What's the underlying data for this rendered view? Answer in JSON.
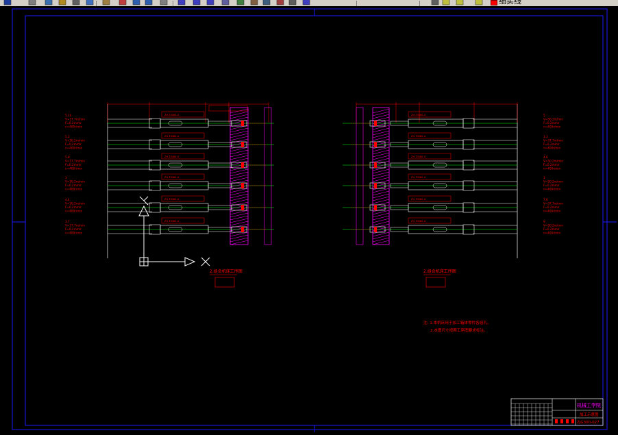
{
  "toolbar": {
    "buttons": [
      {
        "name": "save-icon"
      },
      {
        "name": "print-icon"
      },
      {
        "name": "preview-icon"
      },
      {
        "name": "publish-icon"
      },
      {
        "name": "cut-icon"
      },
      {
        "name": "copy-icon"
      },
      {
        "name": "paste-icon"
      },
      {
        "name": "match-properties-icon"
      },
      {
        "name": "undo-icon"
      },
      {
        "name": "redo-icon"
      },
      {
        "name": "pan-icon"
      },
      {
        "name": "zoom-realtime-icon"
      },
      {
        "name": "zoom-window-icon"
      },
      {
        "name": "zoom-previous-icon"
      },
      {
        "name": "properties-icon"
      },
      {
        "name": "design-center-icon"
      },
      {
        "name": "tool-palettes-icon"
      },
      {
        "name": "sheet-set-icon"
      },
      {
        "name": "markup-icon"
      },
      {
        "name": "calculator-icon"
      },
      {
        "name": "help-icon"
      },
      {
        "name": "layer-manager-icon"
      },
      {
        "name": "layer-visibility-icon"
      },
      {
        "name": "layer-freeze-icon"
      },
      {
        "name": "layer-lock-icon"
      }
    ],
    "current_layer": "细实线",
    "layer_color": "#ff0000"
  },
  "drawing": {
    "colors": {
      "frame": "#1a1aff",
      "annotation": "#ff0000",
      "geometry": "#ffffff",
      "centerline": "#00ff00",
      "hatch": "#ff00ff",
      "ucs": "#ffffff"
    },
    "left_view": {
      "labels": [
        [
          "5.10",
          "V=37.7m/min",
          "F=0.2mm/r",
          "n=400r/min"
        ],
        [
          "5.2",
          "V=50.2m/min",
          "F=0.2mm/r",
          "n=400r/min"
        ],
        [
          "5.8",
          "V=37.7m/min",
          "F=0.2mm/r",
          "n=400r/min"
        ],
        [
          "3",
          "V=50.2m/min",
          "F=0.2mm/r",
          "n=400r/min"
        ],
        [
          "4.4",
          "V=50.2m/min",
          "F=0.2mm/r",
          "n=400r/min"
        ],
        [
          "3.7",
          "V=37.7m/min",
          "F=0.2mm/r",
          "n=400r/min"
        ]
      ],
      "title": "2.组合机床工序图"
    },
    "right_view": {
      "labels": [
        [
          "5",
          "V=50.2m/min",
          "F=0.2mm/r",
          "n=400r/min"
        ],
        [
          "1.3",
          "V=37.7m/min",
          "F=0.2mm/r",
          "n=400r/min"
        ],
        [
          "4.6",
          "V=50.2m/min",
          "F=0.2mm/r",
          "n=400r/min"
        ],
        [
          "3",
          "V=50.2m/min",
          "F=0.2mm/r",
          "n=400r/min"
        ],
        [
          "7.6",
          "V=37.7m/min",
          "F=0.2mm/r",
          "n=400r/min"
        ],
        [
          "9",
          "V=50.2m/min",
          "F=0.2mm/r",
          "n=400r/min"
        ]
      ],
      "title": "2.组合机床工序图"
    },
    "notes": {
      "line1": "注: 1.本机床用于加工箱体零件各组孔。",
      "line2": "2.本图尺寸按照工序图要求标注。"
    },
    "title_block": {
      "school": "机械工学院",
      "drawing_name": "加工示意图",
      "drawing_number": "ZJG300-027"
    },
    "ucs": {
      "x_label": "X",
      "y_label": "Y"
    }
  }
}
